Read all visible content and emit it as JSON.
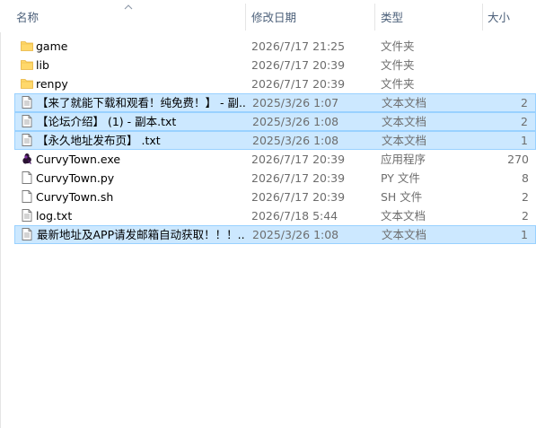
{
  "columns": {
    "name": "名称",
    "modified": "修改日期",
    "type": "类型",
    "size": "大小"
  },
  "files": [
    {
      "name": "game",
      "date": "2026/7/17 21:25",
      "type": "文件夹",
      "size": "",
      "icon": "folder-icon",
      "selected": false
    },
    {
      "name": "lib",
      "date": "2026/7/17 20:39",
      "type": "文件夹",
      "size": "",
      "icon": "folder-icon",
      "selected": false
    },
    {
      "name": "renpy",
      "date": "2026/7/17 20:39",
      "type": "文件夹",
      "size": "",
      "icon": "folder-icon",
      "selected": false
    },
    {
      "name": "【来了就能下载和观看！纯免费！】 - 副...",
      "date": "2025/3/26 1:07",
      "type": "文本文档",
      "size": "2",
      "icon": "text-file-icon",
      "selected": true
    },
    {
      "name": "【论坛介绍】 (1) - 副本.txt",
      "date": "2025/3/26 1:08",
      "type": "文本文档",
      "size": "2",
      "icon": "text-file-icon",
      "selected": true
    },
    {
      "name": "【永久地址发布页】 .txt",
      "date": "2025/3/26 1:08",
      "type": "文本文档",
      "size": "1",
      "icon": "text-file-icon",
      "selected": true
    },
    {
      "name": "CurvyTown.exe",
      "date": "2026/7/17 20:39",
      "type": "应用程序",
      "size": "270",
      "icon": "app-exe-icon",
      "selected": false
    },
    {
      "name": "CurvyTown.py",
      "date": "2026/7/17 20:39",
      "type": "PY 文件",
      "size": "8",
      "icon": "blank-file-icon",
      "selected": false
    },
    {
      "name": "CurvyTown.sh",
      "date": "2026/7/17 20:39",
      "type": "SH 文件",
      "size": "2",
      "icon": "blank-file-icon",
      "selected": false
    },
    {
      "name": "log.txt",
      "date": "2026/7/18 5:44",
      "type": "文本文档",
      "size": "2",
      "icon": "text-file-icon",
      "selected": false
    },
    {
      "name": "最新地址及APP请发邮箱自动获取！！！...",
      "date": "2025/3/26 1:08",
      "type": "文本文档",
      "size": "1",
      "icon": "text-file-icon",
      "selected": true
    }
  ],
  "colors": {
    "selection_bg": "#cce8ff",
    "selection_border": "#99d1ff",
    "folder": "#ffd86b",
    "header_text": "#4c607a"
  }
}
